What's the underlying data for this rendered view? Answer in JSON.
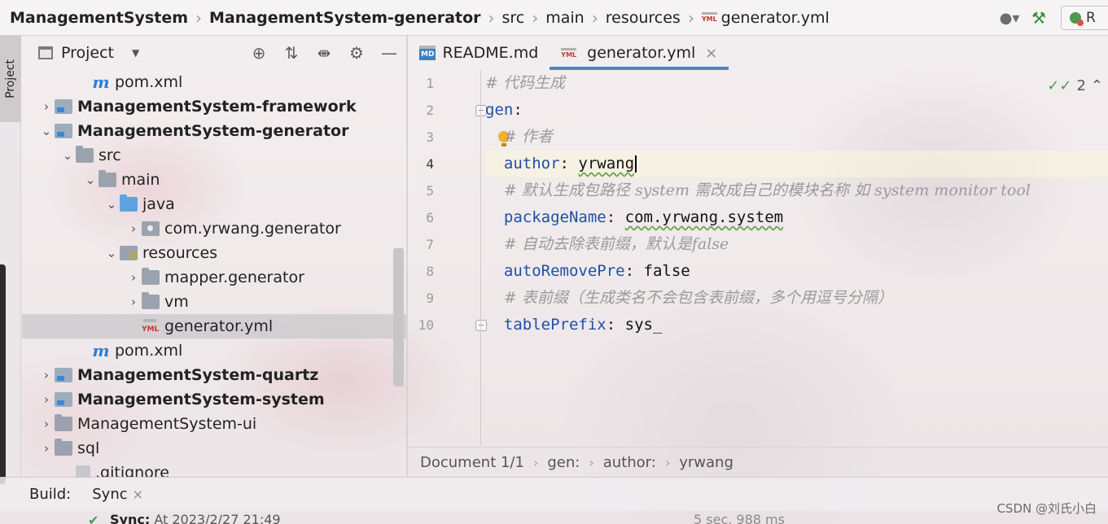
{
  "breadcrumb": {
    "items": [
      "ManagementSystem",
      "ManagementSystem-generator",
      "src",
      "main",
      "resources",
      "generator.yml"
    ],
    "file_badge": "YML"
  },
  "toolbar": {
    "run_label": "R"
  },
  "project_panel": {
    "vertical_tab_label": "Project",
    "title": "Project",
    "tree": [
      {
        "label": "pom.xml",
        "icon": "maven",
        "bold": false
      },
      {
        "label": "ManagementSystem-framework",
        "icon": "module",
        "bold": true,
        "expanded": false
      },
      {
        "label": "ManagementSystem-generator",
        "icon": "module",
        "bold": true,
        "expanded": true
      },
      {
        "label": "src",
        "icon": "folder",
        "bold": false,
        "expanded": true
      },
      {
        "label": "main",
        "icon": "folder",
        "bold": false,
        "expanded": true
      },
      {
        "label": "java",
        "icon": "folder-blue",
        "bold": false,
        "expanded": true
      },
      {
        "label": "com.yrwang.generator",
        "icon": "package",
        "bold": false,
        "expanded": false
      },
      {
        "label": "resources",
        "icon": "resources",
        "bold": false,
        "expanded": true
      },
      {
        "label": "mapper.generator",
        "icon": "folder",
        "bold": false,
        "expanded": false
      },
      {
        "label": "vm",
        "icon": "folder",
        "bold": false,
        "expanded": false
      },
      {
        "label": "generator.yml",
        "icon": "yml",
        "bold": false,
        "selected": true
      },
      {
        "label": "pom.xml",
        "icon": "maven",
        "bold": false
      },
      {
        "label": "ManagementSystem-quartz",
        "icon": "module",
        "bold": true,
        "expanded": false
      },
      {
        "label": "ManagementSystem-system",
        "icon": "module",
        "bold": true,
        "expanded": false
      },
      {
        "label": "ManagementSystem-ui",
        "icon": "folder",
        "bold": false,
        "expanded": false
      },
      {
        "label": "sql",
        "icon": "folder",
        "bold": false,
        "expanded": false
      },
      {
        "label": ".gitignore",
        "icon": "file",
        "bold": false
      }
    ]
  },
  "editor": {
    "tabs": [
      {
        "label": "README.md",
        "badge": "MD",
        "active": false
      },
      {
        "label": "generator.yml",
        "badge": "YML",
        "active": true
      }
    ],
    "inspection_count": "2",
    "current_line": 4,
    "lines": [
      {
        "num": "1",
        "comment": "# 代码生成"
      },
      {
        "num": "2",
        "key": "gen",
        "sep": ":"
      },
      {
        "num": "3",
        "comment": "# 作者"
      },
      {
        "num": "4",
        "key": "author",
        "sep": ": ",
        "value": "yrwang"
      },
      {
        "num": "5",
        "comment": "# 默认生成包路径 system 需改成自己的模块名称 如 system monitor tool"
      },
      {
        "num": "6",
        "key": "packageName",
        "sep": ": ",
        "value": "com.yrwang.system"
      },
      {
        "num": "7",
        "comment": "# 自动去除表前缀，默认是false"
      },
      {
        "num": "8",
        "key": "autoRemovePre",
        "sep": ": ",
        "value": "false"
      },
      {
        "num": "9",
        "comment": "# 表前缀（生成类名不会包含表前缀，多个用逗号分隔）"
      },
      {
        "num": "10",
        "key": "tablePrefix",
        "sep": ": ",
        "value": "sys_"
      }
    ],
    "breadcrumbs": [
      "Document 1/1",
      "gen:",
      "author:",
      "yrwang"
    ]
  },
  "build": {
    "label": "Build:",
    "tab": "Sync",
    "status_bold": "Sync:",
    "status_text": " At 2023/2/27 21:49",
    "duration": "5 sec, 988 ms"
  },
  "watermark": "CSDN @刘氏小白"
}
